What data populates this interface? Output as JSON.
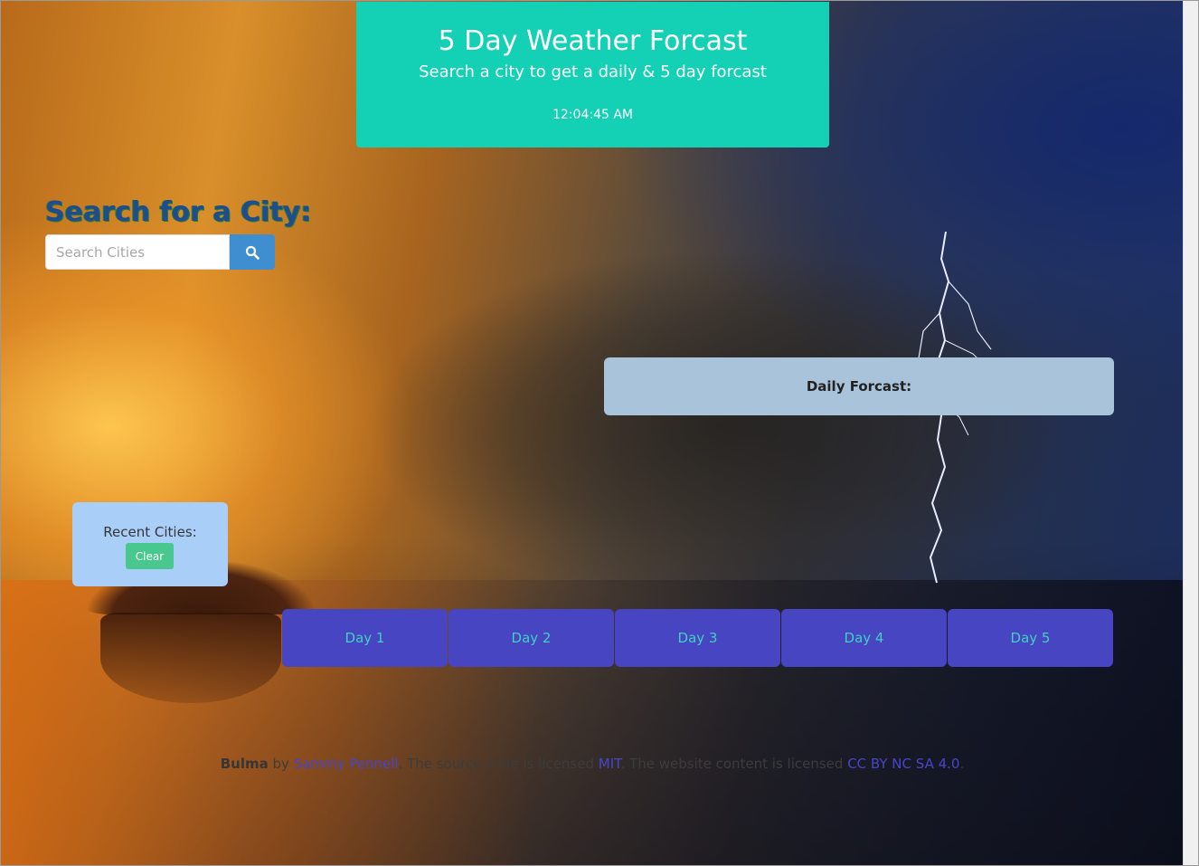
{
  "header": {
    "title": "5 Day Weather Forcast",
    "subtitle": "Search a city to get a daily & 5 day forcast",
    "time": "12:04:45 AM"
  },
  "search": {
    "heading": "Search for a City:",
    "placeholder": "Search Cities",
    "value": "",
    "button_icon": "search-icon"
  },
  "daily": {
    "label": "Daily Forcast:"
  },
  "recent": {
    "label": "Recent Cities:",
    "clear_label": "Clear"
  },
  "days": [
    {
      "label": "Day 1"
    },
    {
      "label": "Day 2"
    },
    {
      "label": "Day 3"
    },
    {
      "label": "Day 4"
    },
    {
      "label": "Day 5"
    }
  ],
  "footer": {
    "brand": "Bulma",
    "by": " by ",
    "author": "Sammy Pennell",
    "text1": ". The source code is licensed ",
    "license1": "MIT",
    "text2": ". The website content is licensed ",
    "license2": "CC BY NC SA 4.0",
    "text3": "."
  },
  "colors": {
    "header_bg": "#14d0b4",
    "search_button": "#3e8ed0",
    "daily_bg": "#a8c3da",
    "recent_bg": "#a9cff8",
    "clear_button": "#48c78e",
    "day_card_bg": "#4845c3",
    "day_card_text": "#3fd0c2",
    "link": "#4a45c8"
  }
}
